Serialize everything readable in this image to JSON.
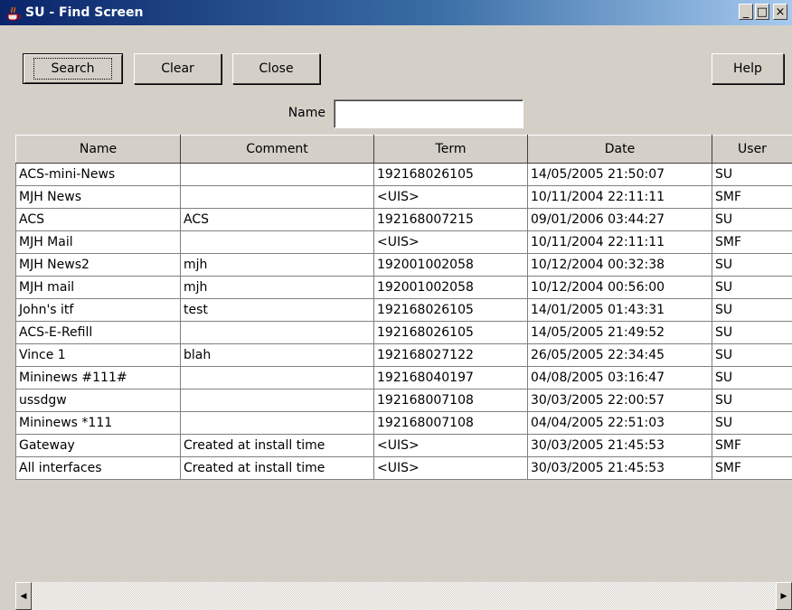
{
  "window": {
    "title": "SU - Find Screen",
    "controls": {
      "minimize": "_",
      "maximize": "□",
      "close": "×"
    }
  },
  "toolbar": {
    "search_label": "Search",
    "clear_label": "Clear",
    "close_label": "Close",
    "help_label": "Help"
  },
  "filter": {
    "name_label": "Name",
    "name_value": ""
  },
  "table": {
    "columns": [
      "Name",
      "Comment",
      "Term",
      "Date",
      "User"
    ],
    "rows": [
      [
        "ACS-mini-News",
        "",
        "192168026105",
        "14/05/2005 21:50:07",
        "SU"
      ],
      [
        "MJH News",
        "",
        "<UIS>",
        "10/11/2004 22:11:11",
        "SMF"
      ],
      [
        "ACS",
        "ACS",
        "192168007215",
        "09/01/2006 03:44:27",
        "SU"
      ],
      [
        "MJH Mail",
        "",
        "<UIS>",
        "10/11/2004 22:11:11",
        "SMF"
      ],
      [
        "MJH News2",
        "mjh",
        "192001002058",
        "10/12/2004 00:32:38",
        "SU"
      ],
      [
        "MJH mail",
        "mjh",
        "192001002058",
        "10/12/2004 00:56:00",
        "SU"
      ],
      [
        "John's itf",
        "test",
        "192168026105",
        "14/01/2005 01:43:31",
        "SU"
      ],
      [
        "ACS-E-Refill",
        "",
        "192168026105",
        "14/05/2005 21:49:52",
        "SU"
      ],
      [
        "Vince 1",
        "blah",
        "192168027122",
        "26/05/2005 22:34:45",
        "SU"
      ],
      [
        "Mininews #111#",
        "",
        "192168040197",
        "04/08/2005 03:16:47",
        "SU"
      ],
      [
        "ussdgw",
        "",
        "192168007108",
        "30/03/2005 22:00:57",
        "SU"
      ],
      [
        "Mininews *111",
        "",
        "192168007108",
        "04/04/2005 22:51:03",
        "SU"
      ],
      [
        "Gateway",
        "Created at install time",
        "<UIS>",
        "30/03/2005 21:45:53",
        "SMF"
      ],
      [
        "All interfaces",
        "Created at install time",
        "<UIS>",
        "30/03/2005 21:45:53",
        "SMF"
      ]
    ]
  },
  "scrollbar": {
    "left_arrow": "◀",
    "right_arrow": "▶"
  }
}
